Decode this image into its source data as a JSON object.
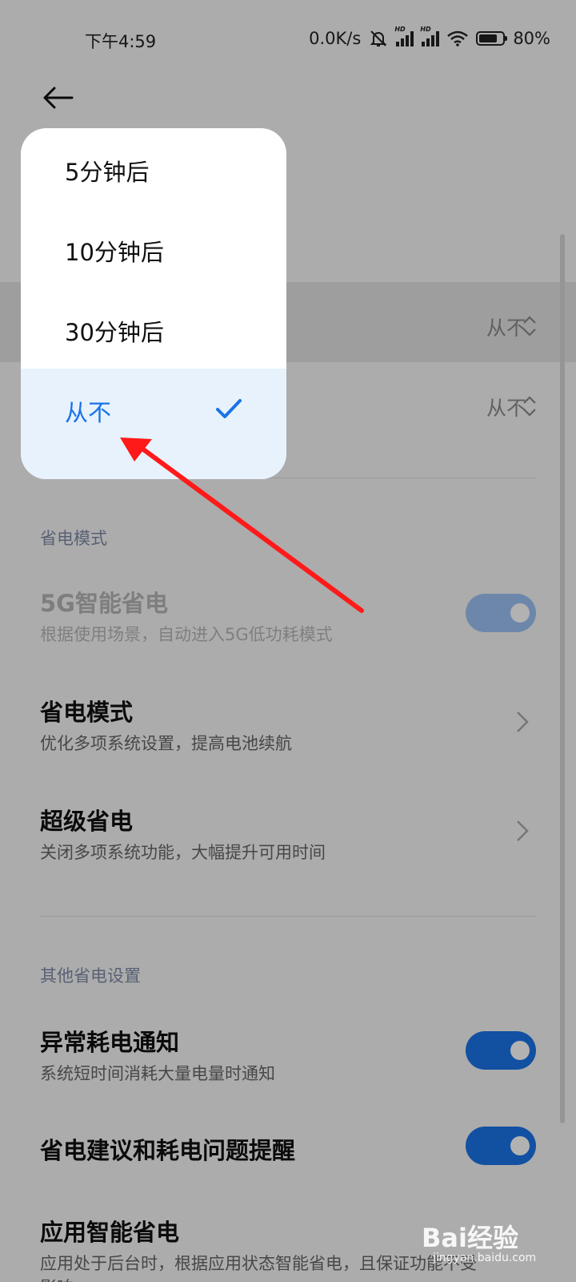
{
  "status_bar": {
    "time": "下午4:59",
    "net_speed": "0.0K/s",
    "battery_text": "80%",
    "battery_level": 0.8,
    "icons": [
      "mute-bell-icon",
      "hd-signal-icon",
      "hd-signal-icon",
      "wifi-icon",
      "battery-icon"
    ]
  },
  "header": {
    "back_icon": "arrow-left-icon"
  },
  "screen_lock_rows": [
    {
      "value": "从不"
    },
    {
      "value": "从不"
    }
  ],
  "popup": {
    "options": [
      {
        "label": "5分钟后",
        "selected": false
      },
      {
        "label": "10分钟后",
        "selected": false
      },
      {
        "label": "30分钟后",
        "selected": false
      },
      {
        "label": "从不",
        "selected": true
      }
    ]
  },
  "power_mode_section": {
    "header": "省电模式",
    "items": [
      {
        "title": "5G智能省电",
        "subtitle": "根据使用场景，自动进入5G低功耗模式",
        "type": "toggle",
        "on": true,
        "disabled": true
      },
      {
        "title": "省电模式",
        "subtitle": "优化多项系统设置，提高电池续航",
        "type": "link"
      },
      {
        "title": "超级省电",
        "subtitle": "关闭多项系统功能，大幅提升可用时间",
        "type": "link"
      }
    ]
  },
  "other_section": {
    "header": "其他省电设置",
    "items": [
      {
        "title": "异常耗电通知",
        "subtitle": "系统短时间消耗大量电量时通知",
        "type": "toggle",
        "on": true
      },
      {
        "title": "省电建议和耗电问题提醒",
        "type": "toggle",
        "on": true
      },
      {
        "title": "应用智能省电",
        "subtitle": "应用处于后台时，根据应用状态智能省电，且保证功能不受影响",
        "type": "link"
      }
    ]
  },
  "colors": {
    "accent": "#1a73e8",
    "annotation_arrow": "#ff1a1a",
    "overlay": "rgba(0,0,0,0.3)"
  },
  "watermark": {
    "brand": "Bai",
    "brand_suffix": "经验",
    "url": "jingyan.baidu.com"
  }
}
